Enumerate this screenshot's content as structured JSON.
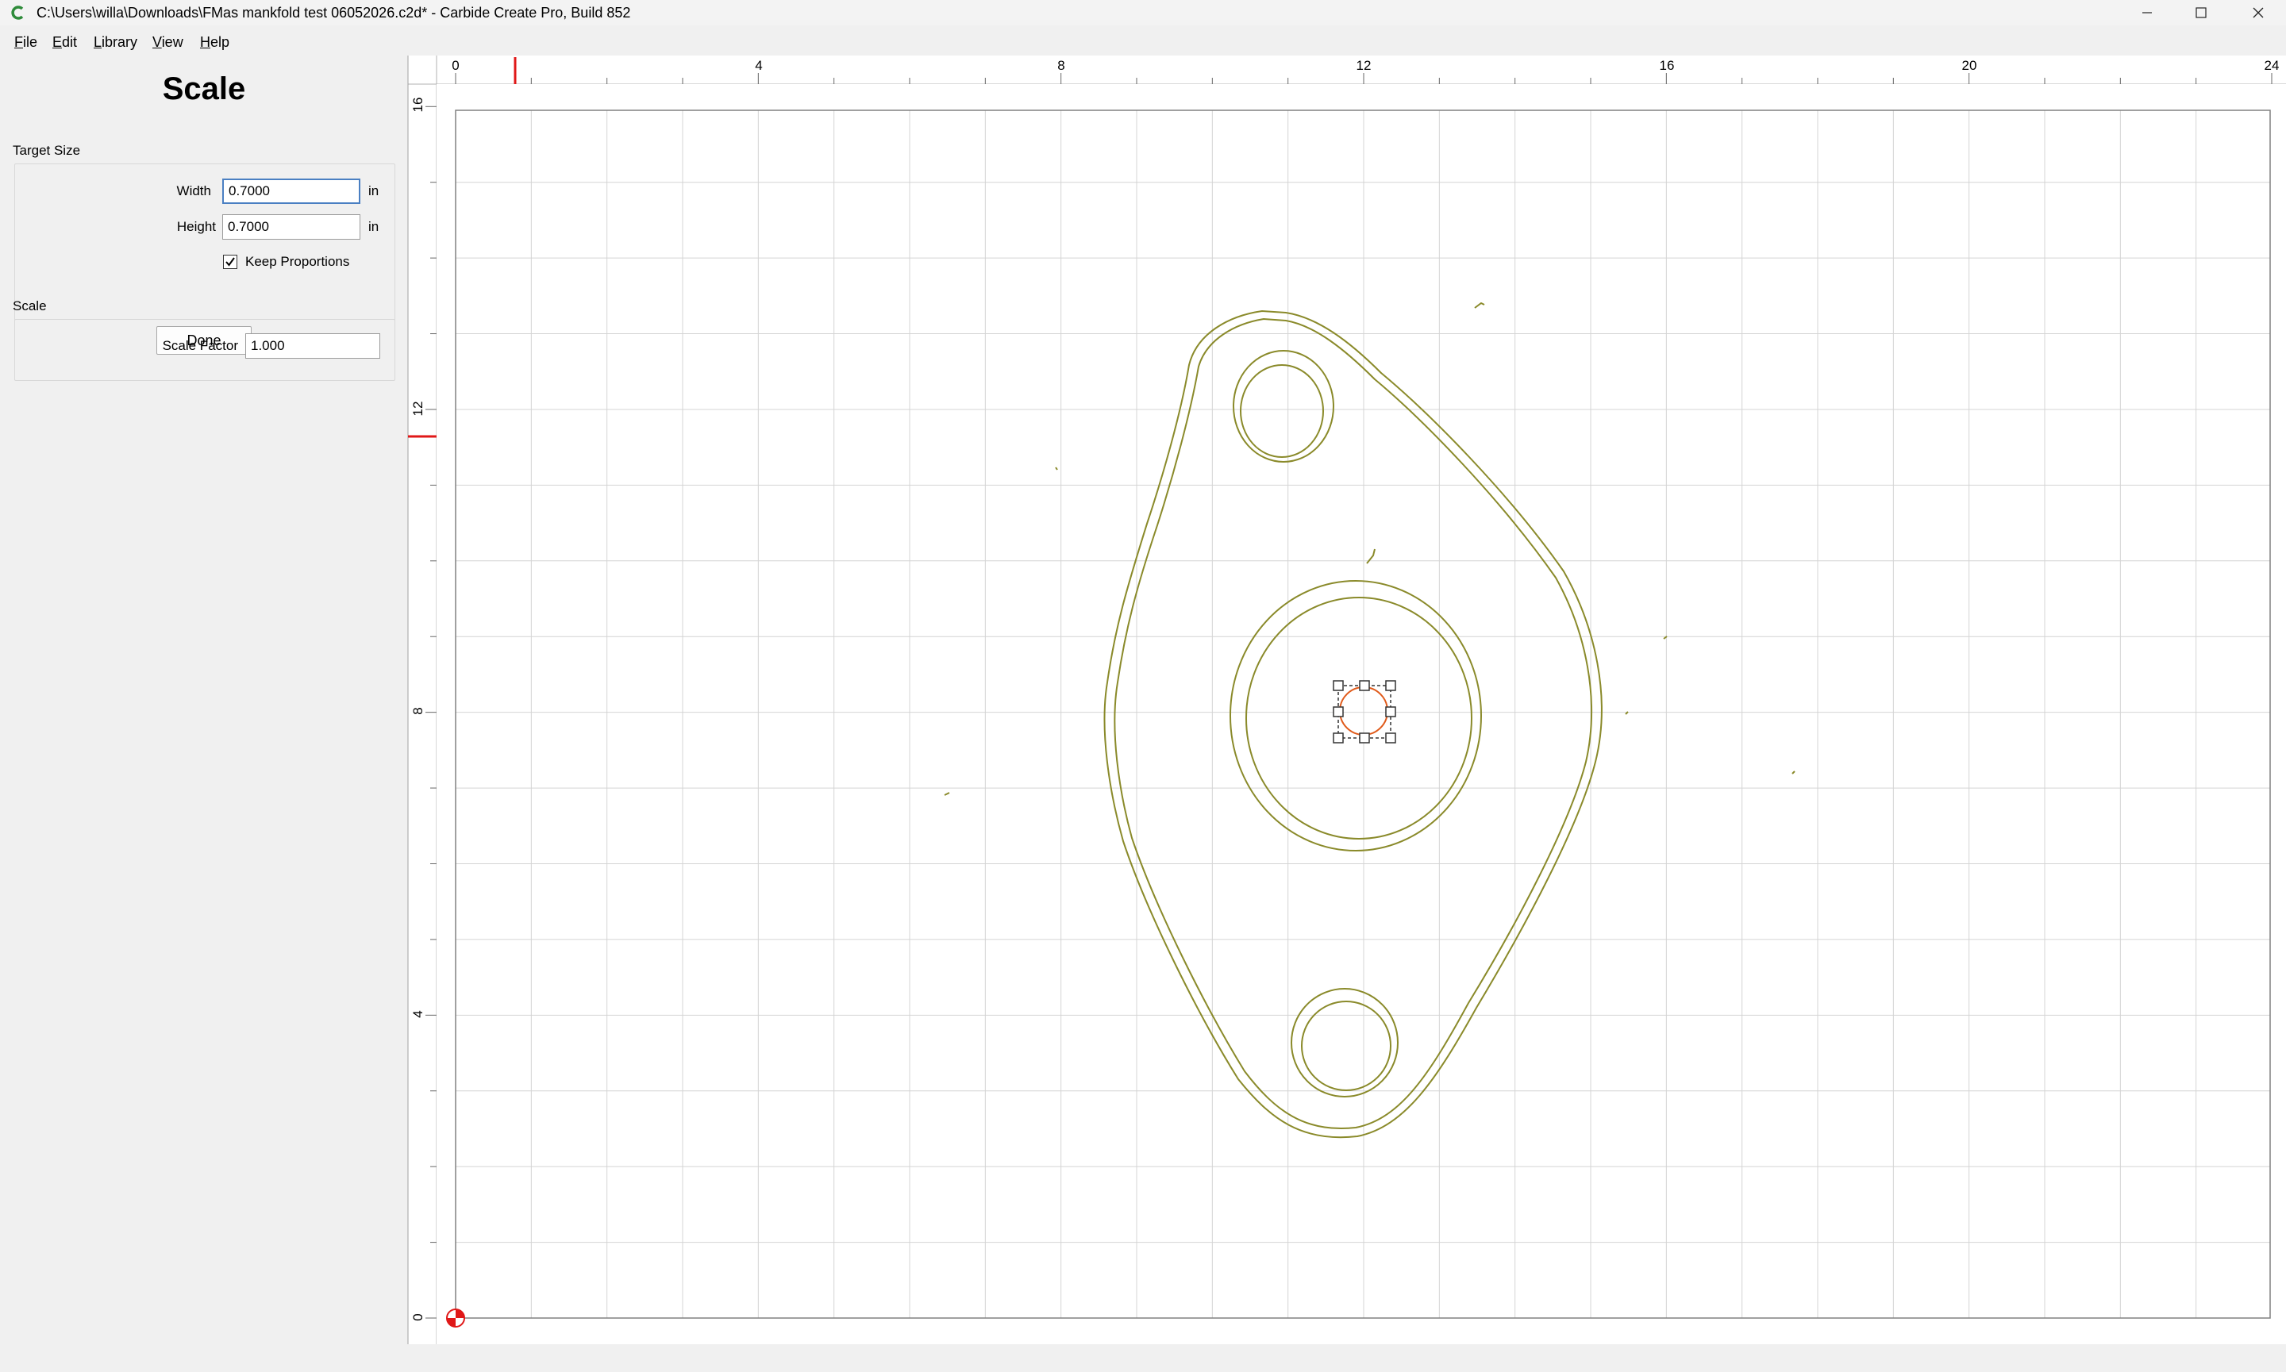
{
  "window": {
    "title": "C:\\Users\\willa\\Downloads\\FMas mankfold test 06052026.c2d* - Carbide Create Pro, Build 852"
  },
  "menu": [
    "File",
    "Edit",
    "Library",
    "View",
    "Help"
  ],
  "panel": {
    "title": "Scale",
    "target_size_label": "Target Size",
    "width_label": "Width",
    "width_value": "0.7000",
    "width_unit": "in",
    "height_label": "Height",
    "height_value": "0.7000",
    "height_unit": "in",
    "keep_proportions_label": "Keep Proportions",
    "keep_proportions_checked": true,
    "scale_section_label": "Scale",
    "scale_factor_label": "Scale Factor",
    "scale_factor_value": "1.000",
    "done_label": "Done"
  },
  "rulers": {
    "top_labels": [
      "0",
      "4",
      "8",
      "12",
      "16",
      "20",
      "24"
    ],
    "left_labels": [
      "16",
      "12",
      "8",
      "4",
      "0"
    ]
  },
  "colors": {
    "vector_stroke": "#8a8a2a",
    "selection": "#333333",
    "selected_shape": "#e05a1a",
    "ruler_marker": "#e01818",
    "grid": "#d4d4d4"
  }
}
